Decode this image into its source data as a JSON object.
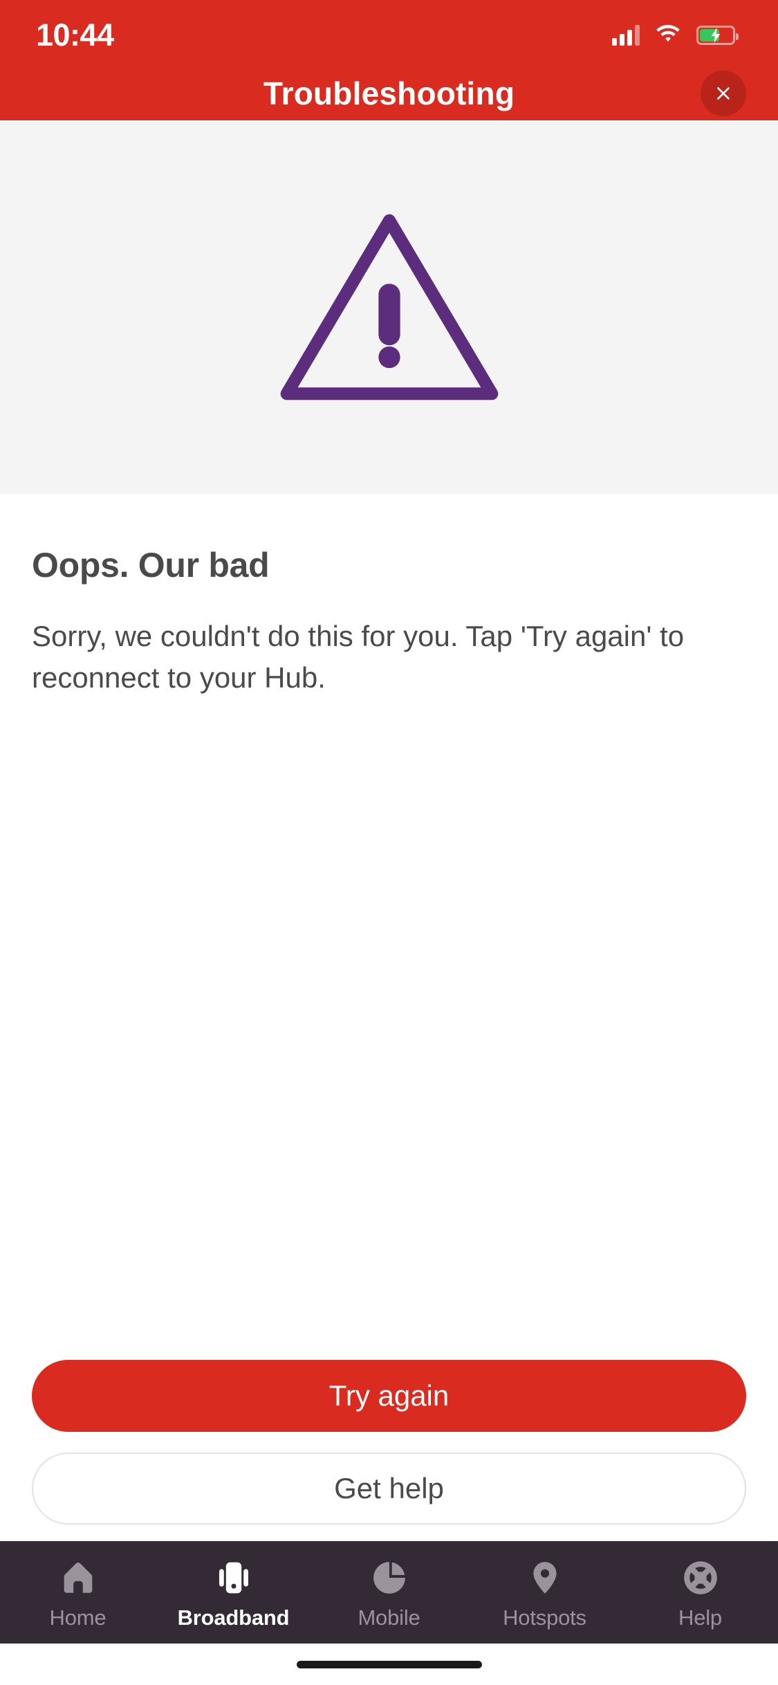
{
  "status_bar": {
    "time": "10:44",
    "signal_icon": "cellular-signal-icon",
    "wifi_icon": "wifi-icon",
    "battery_icon": "battery-charging-icon",
    "battery_charging": true
  },
  "header": {
    "title": "Troubleshooting",
    "close_icon": "close-icon",
    "background_color": "#DA2B20"
  },
  "hero": {
    "icon": "warning-triangle-exclamation-icon",
    "icon_color": "#5C2D7C",
    "background_color": "#F4F4F4"
  },
  "content": {
    "title": "Oops. Our bad",
    "body": "Sorry, we couldn't do this for you. Tap 'Try again' to reconnect to your Hub."
  },
  "actions": {
    "primary_label": "Try again",
    "primary_color": "#DA2B20",
    "secondary_label": "Get help"
  },
  "bottom_nav": {
    "background_color": "#332A36",
    "active_color": "#FFFFFF",
    "inactive_color": "#9B939C",
    "items": [
      {
        "label": "Home",
        "icon": "home-icon",
        "active": false
      },
      {
        "label": "Broadband",
        "icon": "router-hub-icon",
        "active": true
      },
      {
        "label": "Mobile",
        "icon": "data-usage-pie-icon",
        "active": false
      },
      {
        "label": "Hotspots",
        "icon": "location-pin-icon",
        "active": false
      },
      {
        "label": "Help",
        "icon": "life-ring-icon",
        "active": false
      }
    ]
  }
}
